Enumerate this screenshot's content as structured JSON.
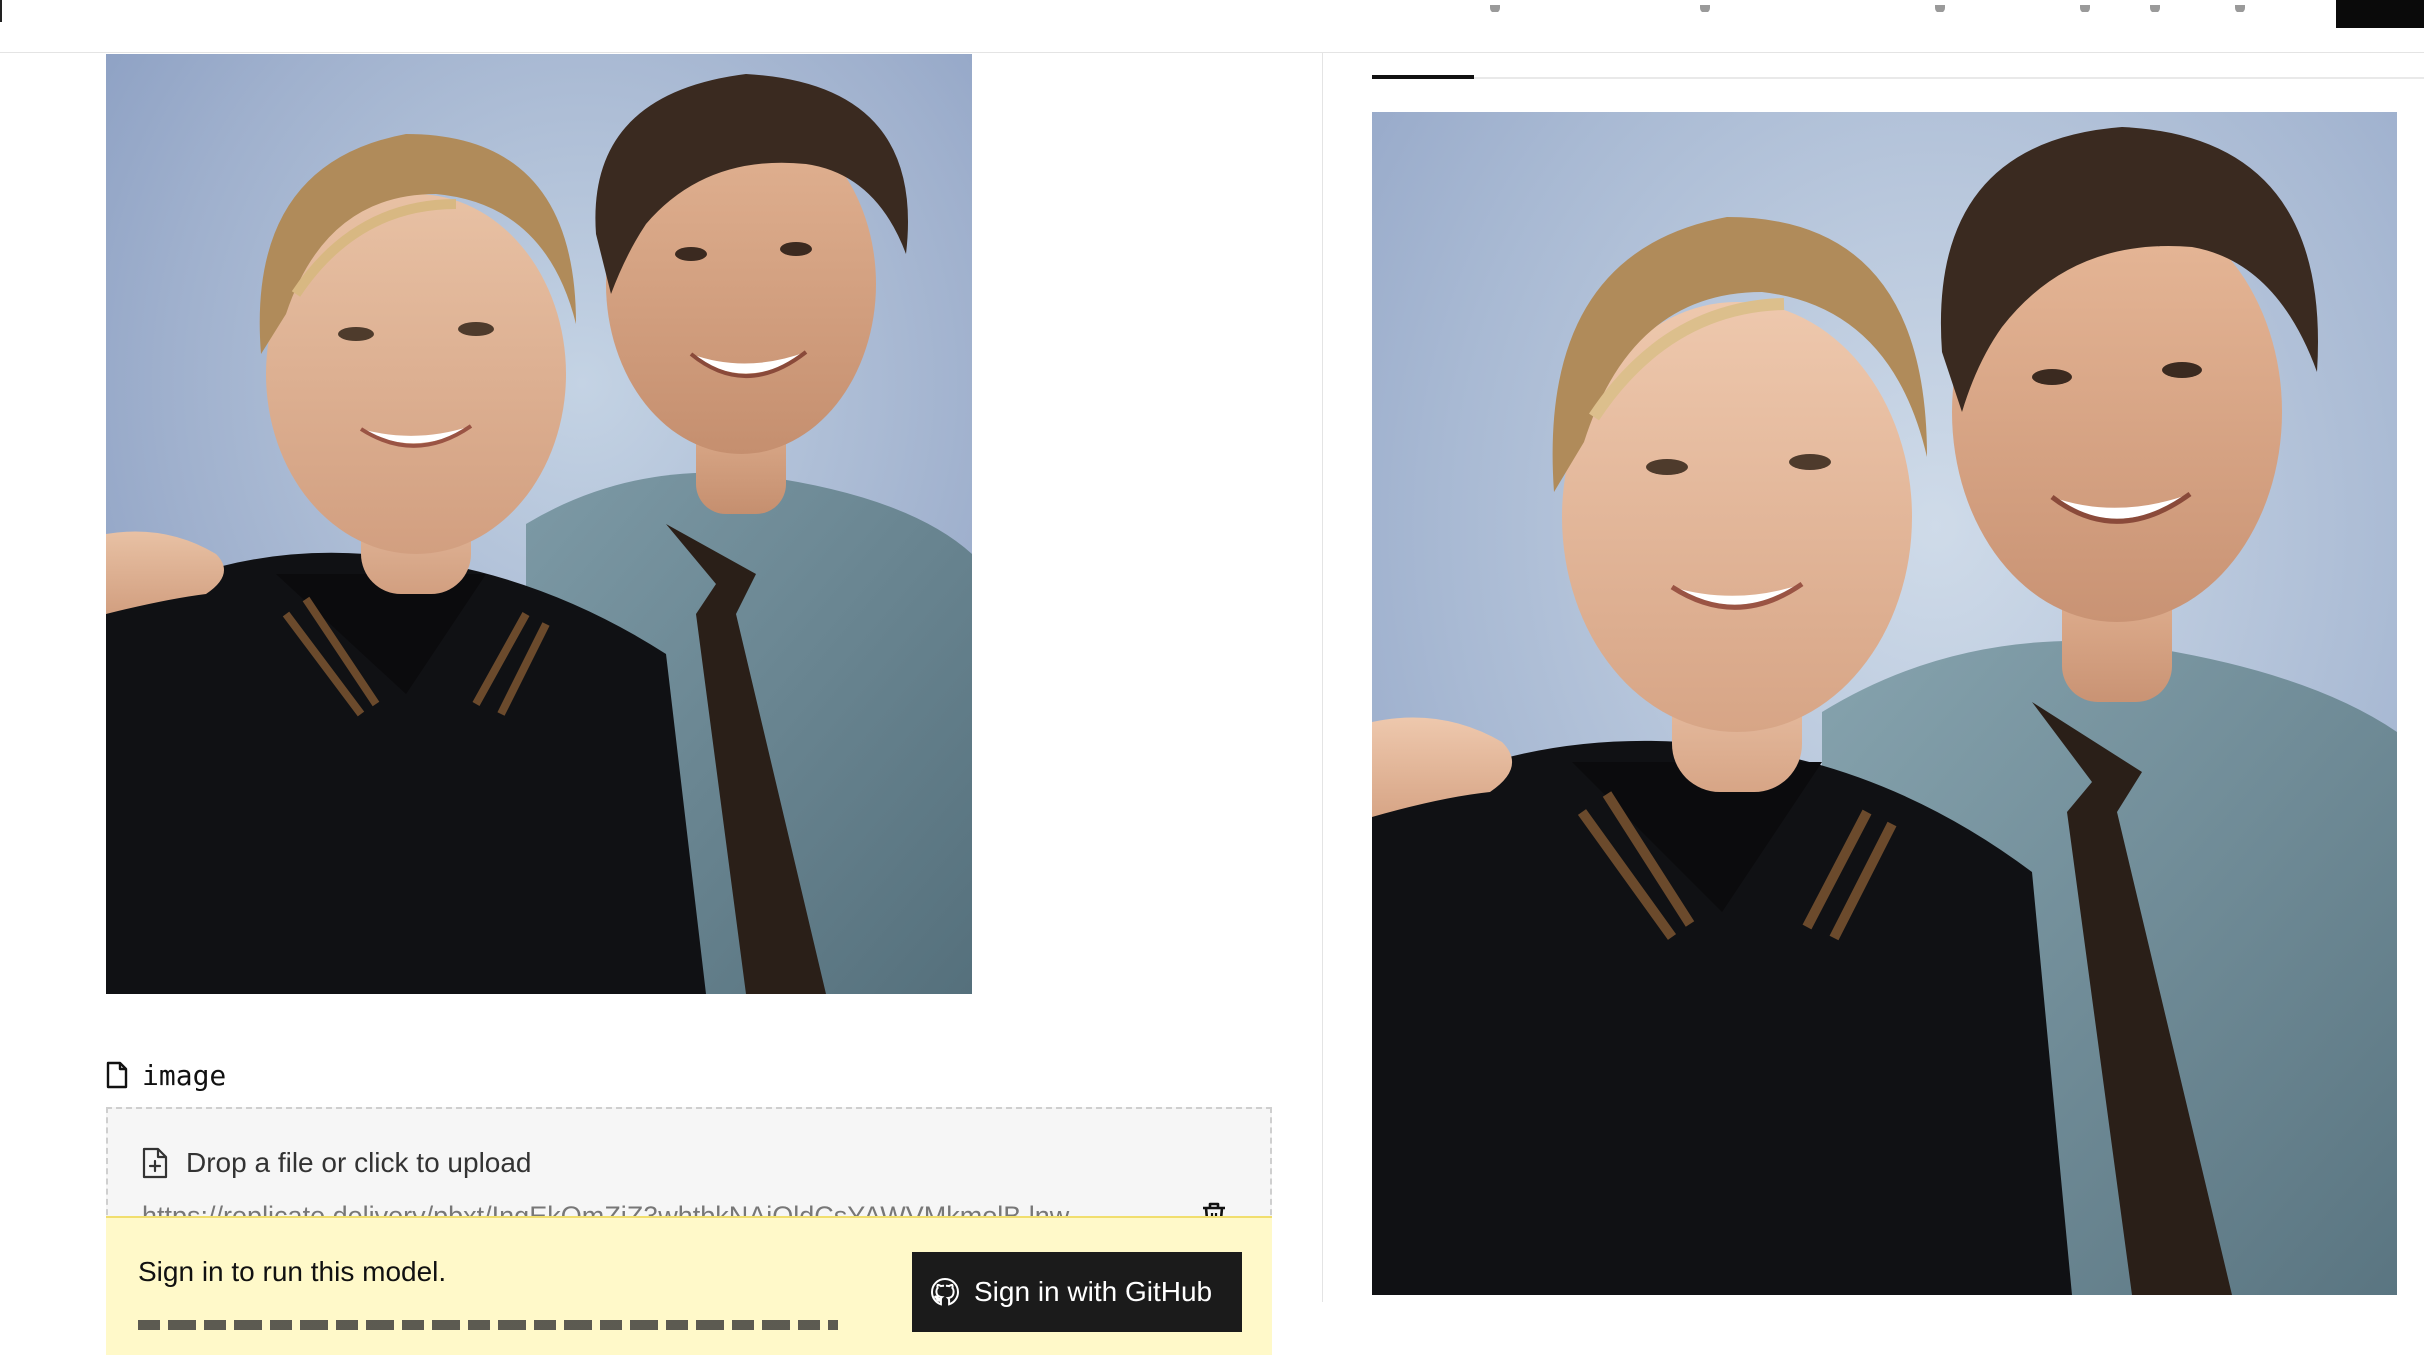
{
  "form": {
    "field_label": "image",
    "dropzone_text": "Drop a file or click to upload",
    "file_url": "https://replicate.delivery/pbxt/IngEkOmZjZ3whtbkNAjOldCsYAWVMkmolB.lnw"
  },
  "auth_banner": {
    "message": "Sign in to run this model.",
    "button_label": "Sign in with GitHub"
  },
  "colors": {
    "banner_background": "#fff9c9",
    "button_background": "#1b1b1b",
    "active_tab": "#111111"
  },
  "icons": {
    "field": "file-icon",
    "upload": "file-plus-icon",
    "delete": "trash-icon",
    "button": "github-icon"
  }
}
